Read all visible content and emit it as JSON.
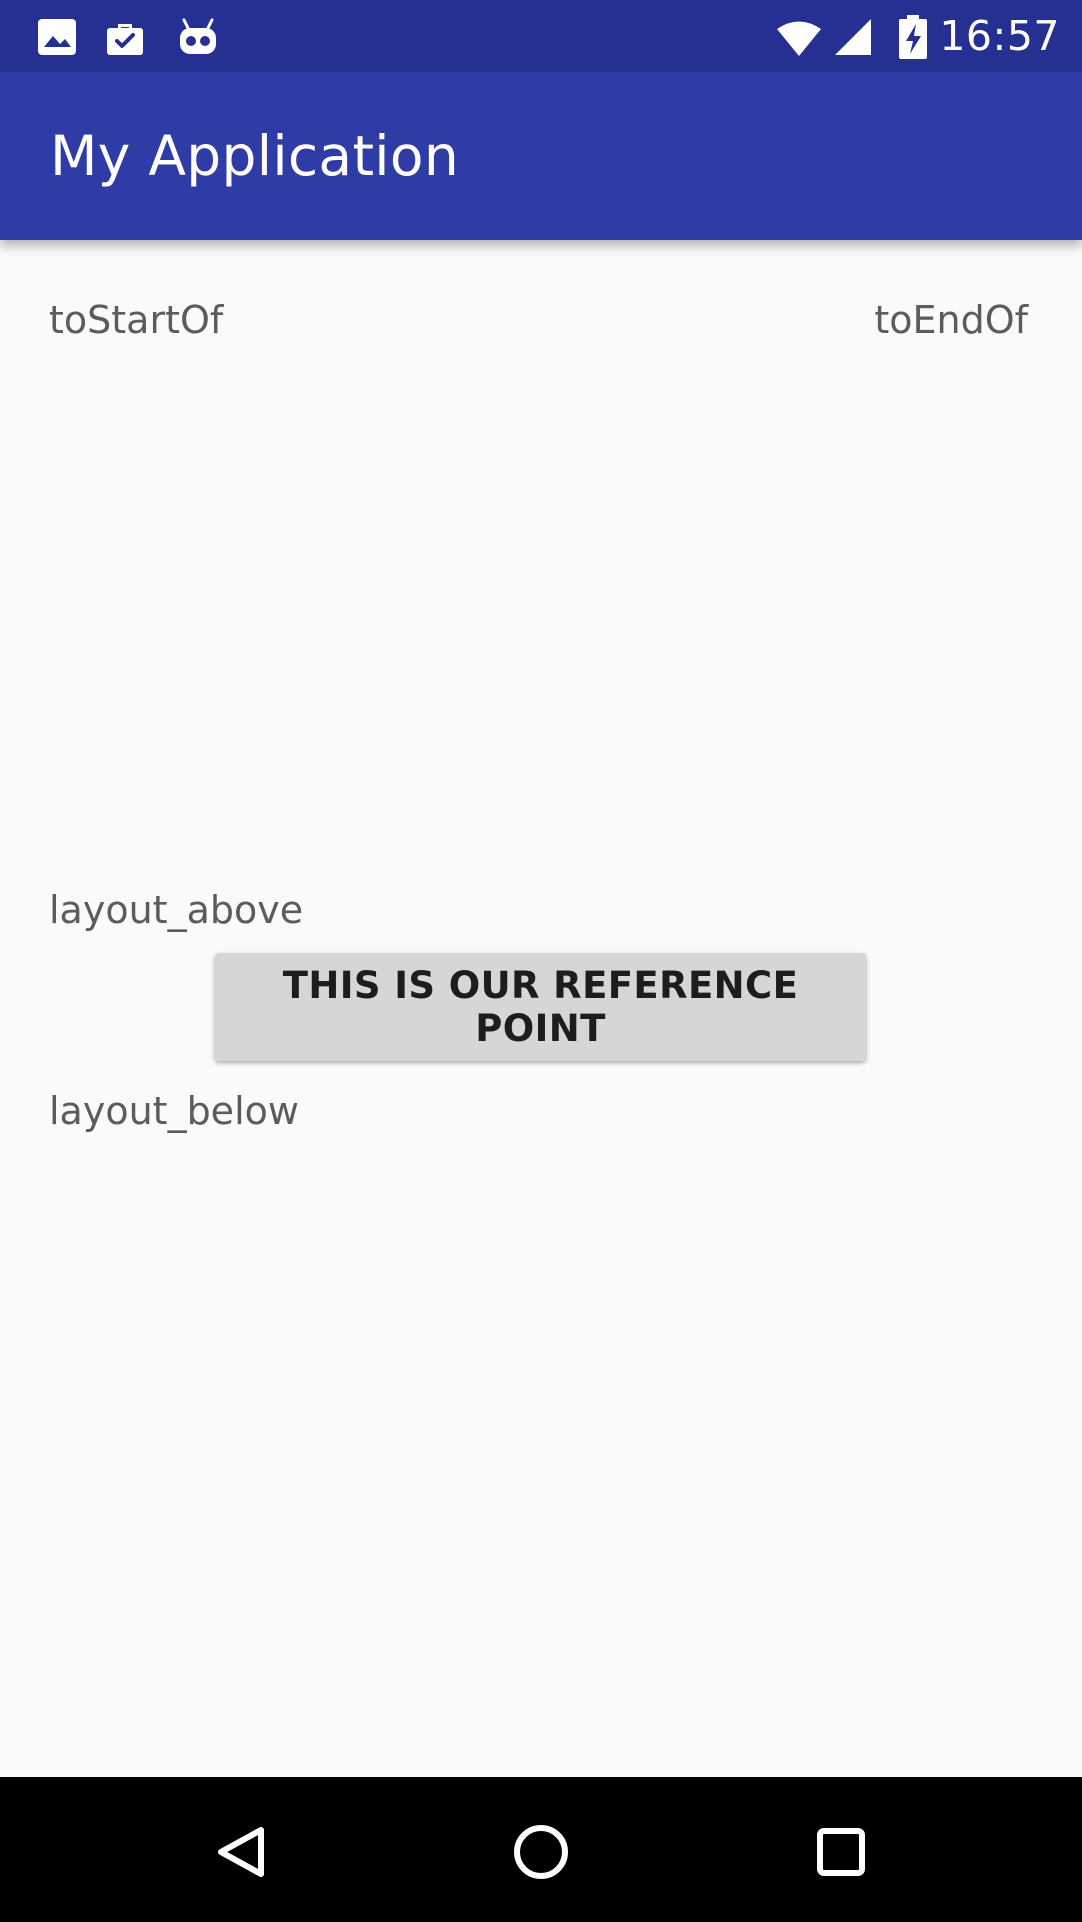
{
  "status_bar": {
    "time": "16:57",
    "icons": [
      "gallery-icon",
      "work-briefcase-icon",
      "robot-icon",
      "wifi-icon",
      "cell-signal-icon",
      "battery-charging-icon"
    ]
  },
  "app_bar": {
    "title": "My Application"
  },
  "content": {
    "to_start_of_label": "toStartOf",
    "to_end_of_label": "toEndOf",
    "layout_above_label": "layout_above",
    "reference_button_label": "THIS IS OUR REFERENCE POINT",
    "layout_below_label": "layout_below"
  },
  "navigation_bar": {
    "buttons": [
      "back-icon",
      "home-icon",
      "recents-icon"
    ]
  },
  "colors": {
    "status_bar": "#253092",
    "app_bar": "#303ca6",
    "background": "#fafafa",
    "button": "#d6d6d6",
    "label_text": "#5c5c5c",
    "navigation_bar": "#000000"
  }
}
